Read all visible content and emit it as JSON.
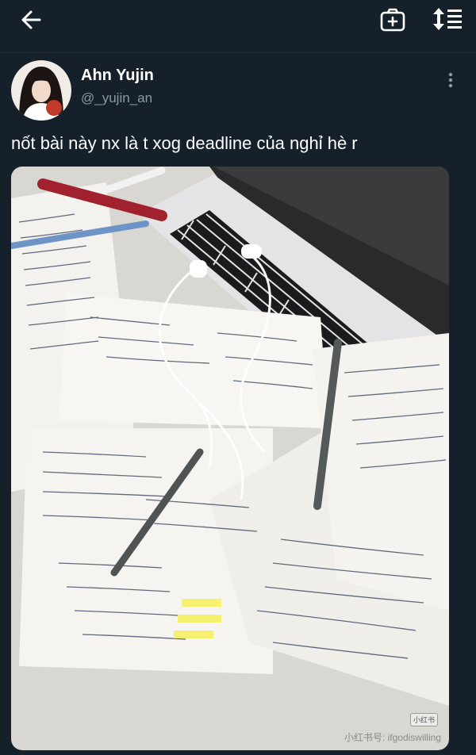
{
  "header": {
    "back_icon": "arrow-left-icon",
    "camera_icon": "camera-plus-icon",
    "sort_icon": "sort-list-icon"
  },
  "tweet": {
    "author_name": "Ahn Yujin",
    "author_handle": "@_yujin_an",
    "text": "nốt bài này nx là t xog deadline của nghỉ hè r",
    "more_icon": "more-vertical-icon"
  },
  "photo": {
    "watermark_badge": "小红书",
    "watermark_source": "小红书号: ifgodiswilling"
  },
  "colors": {
    "background": "#15202b",
    "secondary_text": "#8899a6"
  }
}
